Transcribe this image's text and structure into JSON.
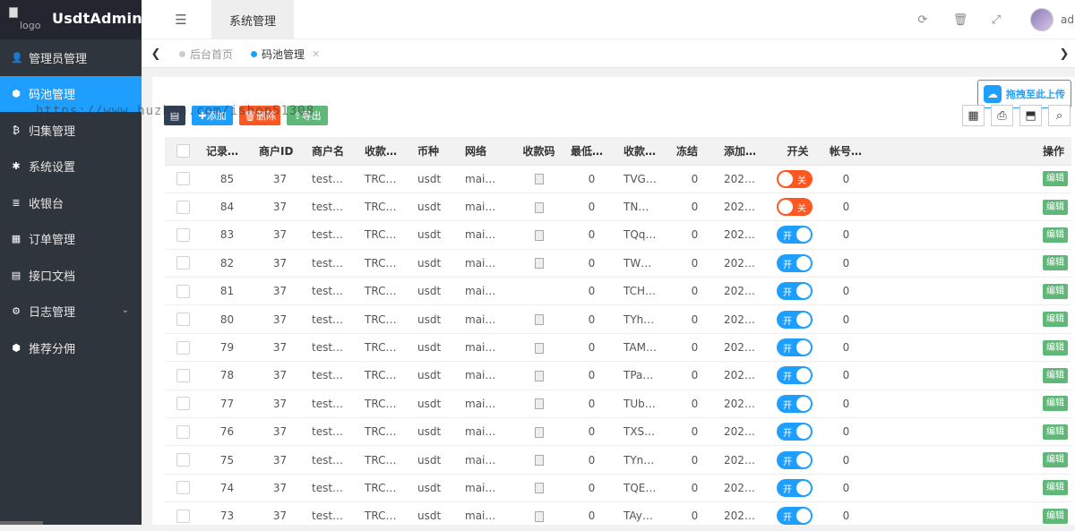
{
  "brand": {
    "title": "UsdtAdmin",
    "logo_alt": "logo"
  },
  "sidebar": {
    "items": [
      {
        "label": "管理员管理",
        "icon": "user-icon",
        "active": false
      },
      {
        "label": "码池管理",
        "icon": "android-icon",
        "active": true
      },
      {
        "label": "归集管理",
        "icon": "bitcoin-icon",
        "active": false
      },
      {
        "label": "系统设置",
        "icon": "gear-icon",
        "active": false
      },
      {
        "label": "收银台",
        "icon": "list-icon",
        "active": false
      },
      {
        "label": "订单管理",
        "icon": "calculator-icon",
        "active": false
      },
      {
        "label": "接口文档",
        "icon": "document-icon",
        "active": false
      },
      {
        "label": "日志管理",
        "icon": "gear-outline-icon",
        "active": false,
        "expandable": true
      },
      {
        "label": "推荐分佣",
        "icon": "android-icon",
        "active": false
      }
    ]
  },
  "topbar": {
    "section_tab": "系统管理",
    "user_name": "ad"
  },
  "tabs": [
    {
      "label": "后台首页",
      "active": false
    },
    {
      "label": "码池管理",
      "active": true
    }
  ],
  "toolbar": {
    "add_label": "添加",
    "delete_label": "删除",
    "export_label": "导出",
    "upload_label": "拖拽至此上传"
  },
  "watermark": "https://www.huzhan.com/ishop51308",
  "table": {
    "columns": [
      "记录…",
      "商户ID",
      "商户名",
      "收款…",
      "币种",
      "网络",
      "收款码",
      "最低…",
      "收款…",
      "冻结",
      "添加…",
      "开关",
      "帐号…",
      "操作"
    ],
    "edit_label": "编辑",
    "delete_label": "删除",
    "switch_on_label": "开",
    "switch_off_label": "关",
    "rows": [
      {
        "id": "85",
        "merchant_id": "37",
        "merchant": "test…",
        "chain": "TRC…",
        "currency": "usdt",
        "network": "mai…",
        "qr": true,
        "min": "0",
        "address": "TVG…",
        "frozen": "0",
        "added": "202…",
        "switch": false,
        "account": "0"
      },
      {
        "id": "84",
        "merchant_id": "37",
        "merchant": "test…",
        "chain": "TRC…",
        "currency": "usdt",
        "network": "mai…",
        "qr": true,
        "min": "0",
        "address": "TN…",
        "frozen": "0",
        "added": "202…",
        "switch": false,
        "account": "0"
      },
      {
        "id": "83",
        "merchant_id": "37",
        "merchant": "test…",
        "chain": "TRC…",
        "currency": "usdt",
        "network": "mai…",
        "qr": true,
        "min": "0",
        "address": "TQq…",
        "frozen": "0",
        "added": "202…",
        "switch": true,
        "account": "0"
      },
      {
        "id": "82",
        "merchant_id": "37",
        "merchant": "test…",
        "chain": "TRC…",
        "currency": "usdt",
        "network": "mai…",
        "qr": true,
        "min": "0",
        "address": "TW…",
        "frozen": "0",
        "added": "202…",
        "switch": true,
        "account": "0"
      },
      {
        "id": "81",
        "merchant_id": "37",
        "merchant": "test…",
        "chain": "TRC…",
        "currency": "usdt",
        "network": "mai…",
        "qr": false,
        "min": "0",
        "address": "TCH…",
        "frozen": "0",
        "added": "202…",
        "switch": true,
        "account": "0"
      },
      {
        "id": "80",
        "merchant_id": "37",
        "merchant": "test…",
        "chain": "TRC…",
        "currency": "usdt",
        "network": "mai…",
        "qr": true,
        "min": "0",
        "address": "TYh…",
        "frozen": "0",
        "added": "202…",
        "switch": true,
        "account": "0"
      },
      {
        "id": "79",
        "merchant_id": "37",
        "merchant": "test…",
        "chain": "TRC…",
        "currency": "usdt",
        "network": "mai…",
        "qr": true,
        "min": "0",
        "address": "TAM…",
        "frozen": "0",
        "added": "202…",
        "switch": true,
        "account": "0"
      },
      {
        "id": "78",
        "merchant_id": "37",
        "merchant": "test…",
        "chain": "TRC…",
        "currency": "usdt",
        "network": "mai…",
        "qr": true,
        "min": "0",
        "address": "TPa…",
        "frozen": "0",
        "added": "202…",
        "switch": true,
        "account": "0"
      },
      {
        "id": "77",
        "merchant_id": "37",
        "merchant": "test…",
        "chain": "TRC…",
        "currency": "usdt",
        "network": "mai…",
        "qr": true,
        "min": "0",
        "address": "TUb…",
        "frozen": "0",
        "added": "202…",
        "switch": true,
        "account": "0"
      },
      {
        "id": "76",
        "merchant_id": "37",
        "merchant": "test…",
        "chain": "TRC…",
        "currency": "usdt",
        "network": "mai…",
        "qr": true,
        "min": "0",
        "address": "TXS…",
        "frozen": "0",
        "added": "202…",
        "switch": true,
        "account": "0"
      },
      {
        "id": "75",
        "merchant_id": "37",
        "merchant": "test…",
        "chain": "TRC…",
        "currency": "usdt",
        "network": "mai…",
        "qr": true,
        "min": "0",
        "address": "TYn…",
        "frozen": "0",
        "added": "202…",
        "switch": true,
        "account": "0"
      },
      {
        "id": "74",
        "merchant_id": "37",
        "merchant": "test…",
        "chain": "TRC…",
        "currency": "usdt",
        "network": "mai…",
        "qr": true,
        "min": "0",
        "address": "TQE…",
        "frozen": "0",
        "added": "202…",
        "switch": true,
        "account": "0"
      },
      {
        "id": "73",
        "merchant_id": "37",
        "merchant": "test…",
        "chain": "TRC…",
        "currency": "usdt",
        "network": "mai…",
        "qr": true,
        "min": "0",
        "address": "TAy…",
        "frozen": "0",
        "added": "202…",
        "switch": true,
        "account": "0"
      }
    ]
  },
  "colors": {
    "sidebar_bg": "#2f353c",
    "active_blue": "#1e9fff",
    "edit_green": "#5fb878",
    "delete_red": "#ff5722"
  }
}
